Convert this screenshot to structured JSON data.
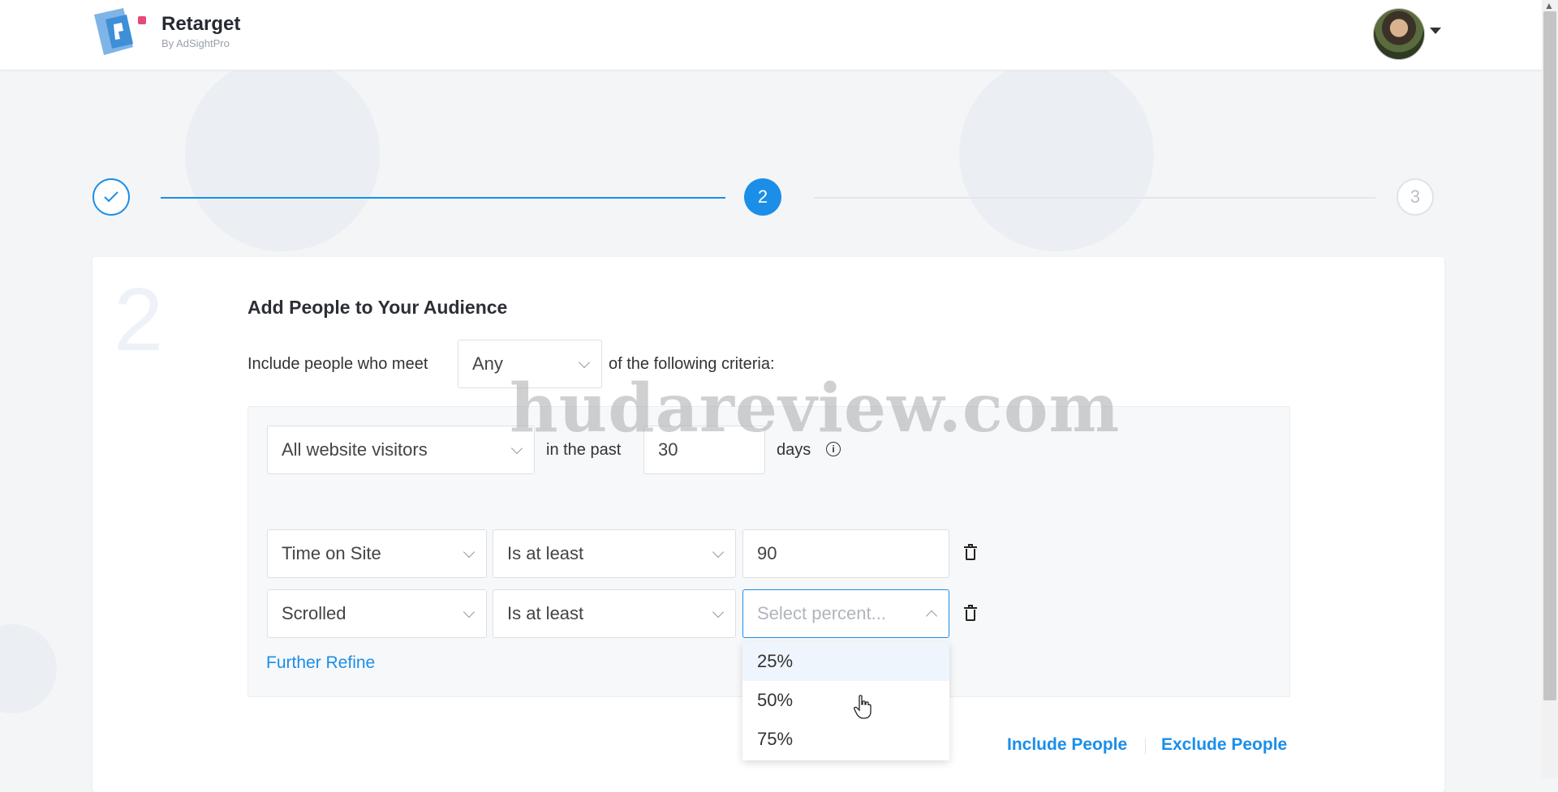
{
  "header": {
    "brand": "Retarget",
    "brand_sub": "By AdSightPro"
  },
  "stepper": {
    "steps": [
      {
        "label": "",
        "state": "done"
      },
      {
        "label": "2",
        "state": "active"
      },
      {
        "label": "3",
        "state": "upcoming"
      }
    ],
    "current": 2
  },
  "card": {
    "step_number": "2",
    "title": "Add People to Your Audience",
    "criteria_prefix": "Include people who meet",
    "criteria_match": "Any",
    "criteria_suffix": "of the following criteria:",
    "audience_select": "All website visitors",
    "in_the_past_label": "in the past",
    "days_value": "30",
    "days_label": "days",
    "rules": [
      {
        "field": "Time on Site",
        "operator": "Is at least",
        "value": "90",
        "placeholder": ""
      },
      {
        "field": "Scrolled",
        "operator": "Is at least",
        "value": "",
        "placeholder": "Select percent..."
      }
    ],
    "further_refine": "Further Refine",
    "include_people": "Include People",
    "exclude_people": "Exclude People"
  },
  "dropdown": {
    "options": [
      "25%",
      "50%",
      "75%"
    ],
    "highlighted": "25%"
  },
  "watermark": "hudareview.com",
  "colors": {
    "accent": "#1b8ee8",
    "background": "#f4f5f7"
  }
}
